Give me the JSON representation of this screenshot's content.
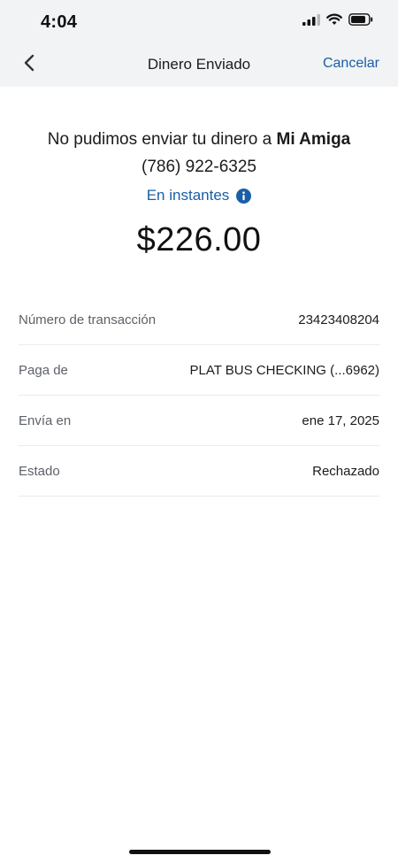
{
  "status_bar": {
    "time": "4:04"
  },
  "nav": {
    "title": "Dinero Enviado",
    "cancel_label": "Cancelar",
    "back_icon": "chevron-left-icon"
  },
  "summary": {
    "message_prefix": "No pudimos enviar tu dinero a ",
    "recipient_name": "Mi Amiga",
    "recipient_phone": "(786) 922-6325",
    "speed_label": "En instantes",
    "amount": "$226.00"
  },
  "details": [
    {
      "label": "Número de transacción",
      "value": "23423408204"
    },
    {
      "label": "Paga de",
      "value": "PLAT BUS CHECKING (...6962)"
    },
    {
      "label": "Envía en",
      "value": "ene 17, 2025"
    },
    {
      "label": "Estado",
      "value": "Rechazado"
    }
  ],
  "colors": {
    "accent": "#1a5fa6",
    "header_background": "#f2f3f5",
    "text": "#1b1b1b",
    "muted_text": "#5d6168"
  }
}
